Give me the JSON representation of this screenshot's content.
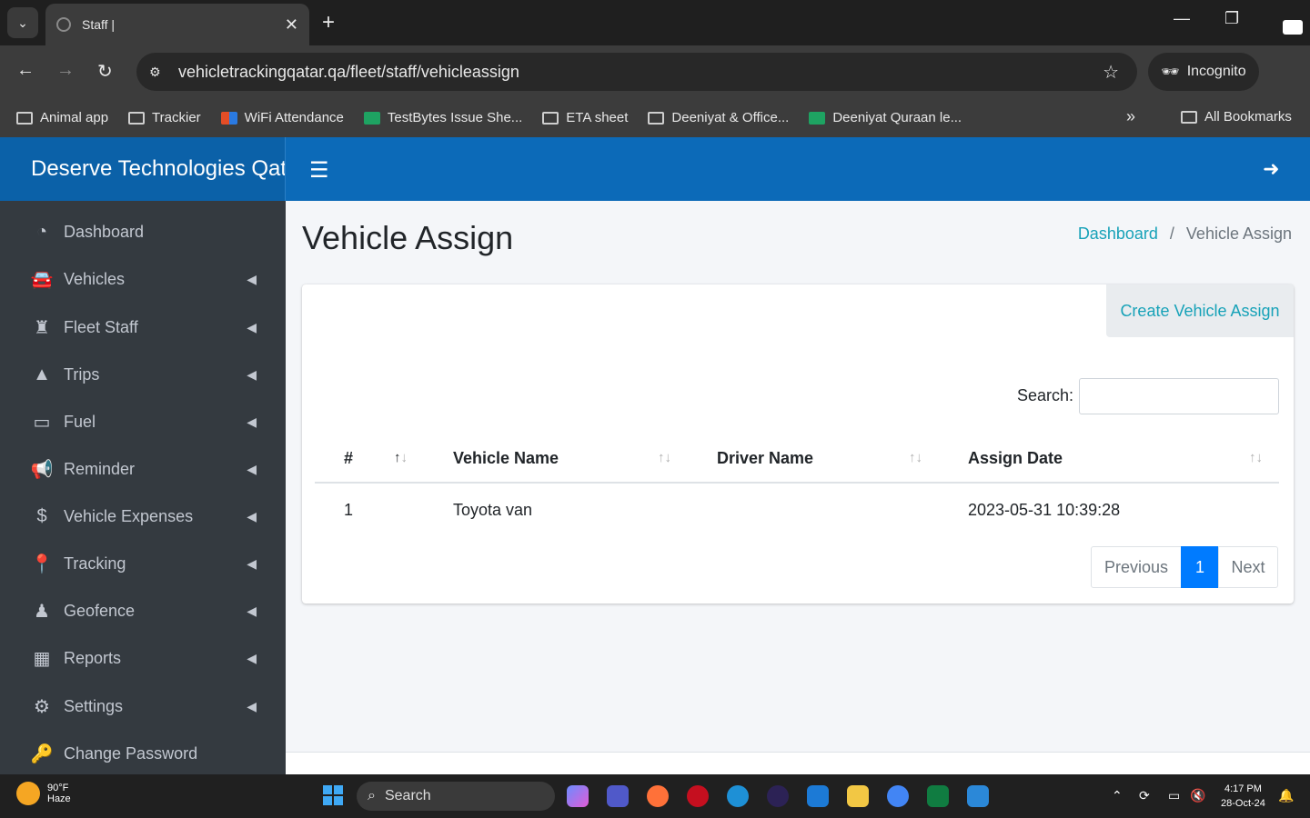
{
  "browser": {
    "tab_title": "Staff |",
    "url": "vehicletrackingqatar.qa/fleet/staff/vehicleassign",
    "incognito_label": "Incognito",
    "bookmarks": [
      "Animal app",
      "Trackier",
      "WiFi Attendance",
      "TestBytes Issue She...",
      "ETA sheet",
      "Deeniyat & Office...",
      "Deeniyat Quraan le..."
    ],
    "all_bookmarks": "All Bookmarks"
  },
  "app": {
    "brand": "Deserve Technologies Qatar"
  },
  "sidebar": {
    "items": [
      {
        "label": "Dashboard",
        "icon": "tachometer-icon"
      },
      {
        "label": "Vehicles",
        "icon": "car-icon"
      },
      {
        "label": "Fleet Staff",
        "icon": "staff-icon"
      },
      {
        "label": "Trips",
        "icon": "road-icon"
      },
      {
        "label": "Fuel",
        "icon": "battery-icon"
      },
      {
        "label": "Reminder",
        "icon": "bullhorn-icon"
      },
      {
        "label": "Vehicle Expenses",
        "icon": "dollar-icon"
      },
      {
        "label": "Tracking",
        "icon": "map-pin-icon"
      },
      {
        "label": "Geofence",
        "icon": "street-view-icon"
      },
      {
        "label": "Reports",
        "icon": "calculator-icon"
      },
      {
        "label": "Settings",
        "icon": "cogs-icon"
      },
      {
        "label": "Change Password",
        "icon": "key-icon"
      }
    ]
  },
  "page": {
    "title": "Vehicle Assign",
    "breadcrumb_link": "Dashboard",
    "breadcrumb_sep": "/",
    "breadcrumb_current": "Vehicle Assign",
    "create_button": "Create Vehicle Assign",
    "search_label": "Search:"
  },
  "table": {
    "headers": [
      "#",
      "Vehicle Name",
      "Driver Name",
      "Assign Date"
    ],
    "rows": [
      [
        "1",
        "Toyota van",
        "",
        "2023-05-31 10:39:28"
      ]
    ]
  },
  "pagination": {
    "previous": "Previous",
    "current": "1",
    "next": "Next"
  },
  "taskbar": {
    "temp": "90°F",
    "condition": "Haze",
    "search_placeholder": "Search",
    "time": "4:17 PM",
    "date": "28-Oct-24"
  },
  "colors": {
    "header": "#0c6ab8",
    "sidebar": "#343a40",
    "link": "#17a2b8",
    "page_active": "#007bff"
  }
}
